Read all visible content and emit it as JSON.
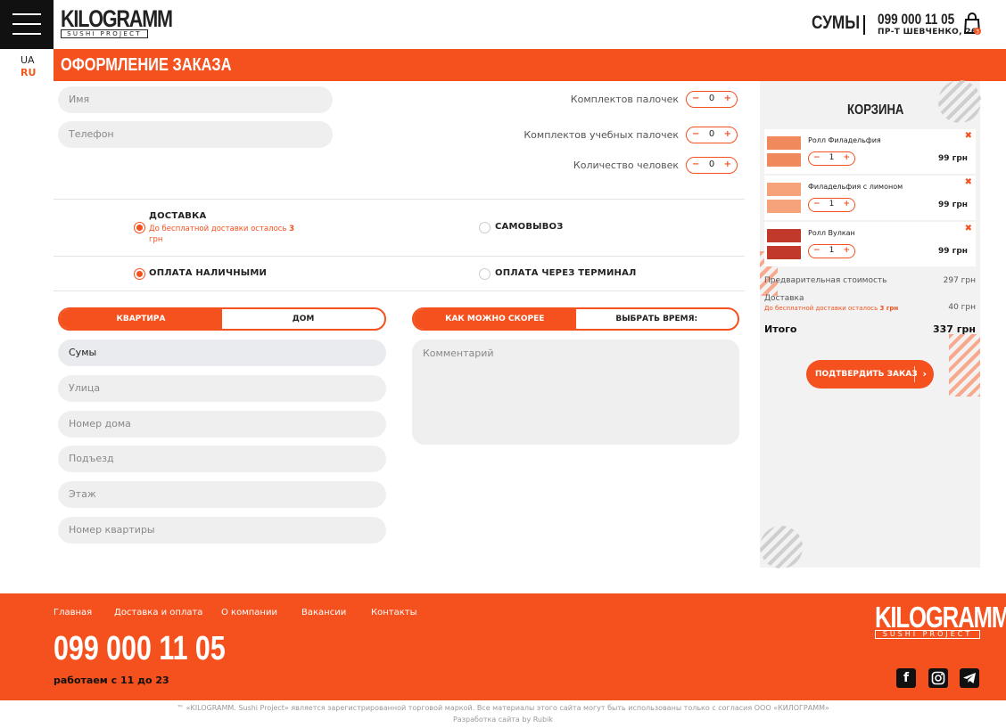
{
  "header": {
    "logo_text": "KILOGRAMM",
    "logo_sub": "SUSHI PROJECT",
    "city": "СУМЫ",
    "phone": "099 000 11 05",
    "address": "ПР-Т ШЕВЧЕНКО, 26",
    "cart_count": "3"
  },
  "lang": {
    "ua": "UA",
    "ru": "RU"
  },
  "page_title": "ОФОРМЛЕНИЕ ЗАКАЗА",
  "contacts": {
    "name_placeholder": "Имя",
    "phone_placeholder": "Телефон"
  },
  "counters": [
    {
      "label": "Комплектов палочек",
      "value": "0"
    },
    {
      "label": "Комплектов учебных палочек",
      "value": "0"
    },
    {
      "label": "Количество человек",
      "value": "0"
    }
  ],
  "delivery": {
    "delivery_label": "ДОСТАВКА",
    "delivery_note": "До бесплатной доставки осталось",
    "delivery_note_amount": "3",
    "delivery_note_unit": "грн",
    "pickup_label": "САМОВЫВОЗ",
    "cash_label": "ОПЛАТА НАЛИЧНЫМИ",
    "terminal_label": "ОПЛАТА ЧЕРЕЗ ТЕРМИНАЛ"
  },
  "address_tabs": {
    "apartment": "КВАРТИРА",
    "house": "ДОМ"
  },
  "time_tabs": {
    "asap": "КАК МОЖНО СКОРЕЕ",
    "choose": "ВЫБРАТЬ ВРЕМЯ:"
  },
  "address": {
    "city": "Сумы",
    "street": "Улица",
    "house": "Номер дома",
    "entrance": "Подъезд",
    "floor": "Этаж",
    "apartment": "Номер квартиры"
  },
  "comment_placeholder": "Комментарий",
  "cart": {
    "title": "КОРЗИНА",
    "items": [
      {
        "name": "Ролл Филадельфия",
        "qty": "1",
        "price": "99 грн"
      },
      {
        "name": "Филадельфия с лимоном",
        "qty": "1",
        "price": "99 грн"
      },
      {
        "name": "Ролл Вулкан",
        "qty": "1",
        "price": "99 грн"
      }
    ],
    "subtotal_label": "Предварительная стоимость",
    "subtotal": "297 грн",
    "delivery_label": "Доставка",
    "delivery_note": "До бесплатной доставки осталось",
    "delivery_note_amount": "3 грн",
    "delivery_price": "40 грн",
    "total_label": "Итого",
    "total": "337 грн",
    "confirm": "ПОДТВЕРДИТЬ ЗАКАЗ"
  },
  "footer": {
    "nav": [
      "Главная",
      "Доставка и оплата",
      "О компании",
      "Вакансии",
      "Контакты"
    ],
    "phone": "099 000 11 05",
    "hours": "работаем с 11 до 23",
    "copyright": "™ «KILOGRAMM. Sushi Project» является зарегистрированной торговой маркой. Все материалы этого сайта могут быть использованы только с согласия ООО «КИЛОГРАММ»",
    "dev": "Разработка сайта by Rubik"
  },
  "icons": {
    "menu": "burger-menu-icon",
    "bag": "shopping-bag-icon",
    "facebook": "facebook-icon",
    "instagram": "instagram-icon",
    "telegram": "telegram-icon"
  },
  "colors": {
    "accent": "#f4511e",
    "dark": "#111111"
  }
}
